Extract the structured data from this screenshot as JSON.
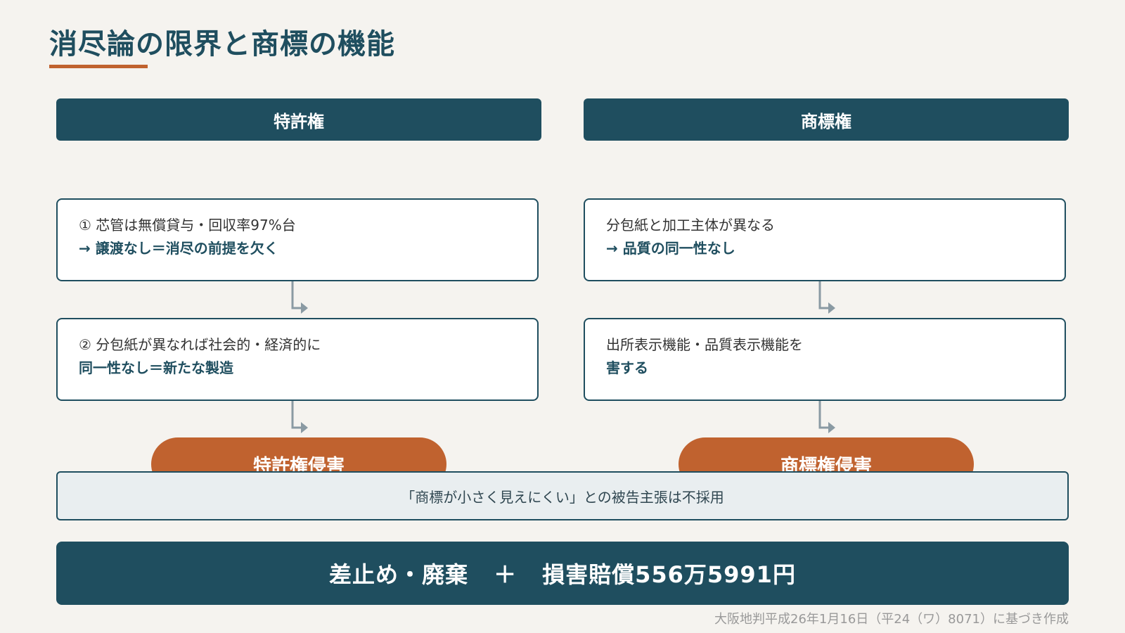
{
  "title": "消尽論の限界と商標の機能",
  "left": {
    "header": "特許権",
    "box1": {
      "line1": "① 芯管は無償貸与・回収率97%台",
      "line2": "→ 譲渡なし＝消尽の前提を欠く"
    },
    "box2": {
      "line1": "② 分包紙が異なれば社会的・経済的に",
      "line2": "同一性なし＝新たな製造"
    },
    "result": "特許権侵害"
  },
  "right": {
    "header": "商標権",
    "box1": {
      "line1": "分包紙と加工主体が異なる",
      "line2": "→ 品質の同一性なし"
    },
    "box2": {
      "line1": "出所表示機能・品質表示機能を",
      "line2": "害する"
    },
    "result": "商標権侵害"
  },
  "note": "「商標が小さく見えにくい」との被告主張は不採用",
  "conclusion": {
    "part1": "差止め・廃棄",
    "plus": "＋",
    "part2": "損害賠償556万5991円"
  },
  "source": "大阪地判平成26年1月16日（平24（ワ）8071）に基づき作成",
  "colors": {
    "primary": "#1f4e5f",
    "accent": "#c0622f",
    "background": "#f5f3ef",
    "arrow": "#8a9aa3"
  }
}
